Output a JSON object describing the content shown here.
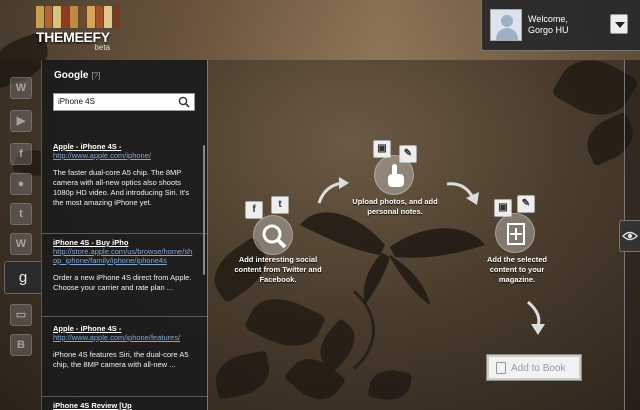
{
  "logo": {
    "title": "THEMEEFY",
    "badge": "beta"
  },
  "user": {
    "welcome": "Welcome,",
    "name": "Gorgo HU"
  },
  "panel": {
    "title": "Google",
    "count": "[?]",
    "search_value": "iPhone 4S",
    "results": [
      {
        "title": "Apple - iPhone 4S -",
        "url": "http://www.apple.com/iphone/",
        "desc": "The faster dual-core A5 chip. The 8MP camera with all-new optics also shoots 1080p HD video. And introducing Siri. It's the most amazing iPhone yet."
      },
      {
        "title": "iPhone 4S - Buy iPho",
        "url": "http://store.apple.com/us/browse/home/shop_iphone/family/iphone/iphone4s",
        "desc": "Order a new iPhone 4S direct from Apple. Choose your carrier and rate plan ..."
      },
      {
        "title": "Apple - iPhone 4S -",
        "url": "http://www.apple.com/iphone/features/",
        "desc": "iPhone 4S features Siri, the dual-core A5 chip, the 8MP camera with all-new ..."
      },
      {
        "title": "iPhone 4S Review [Up",
        "url": "",
        "desc": ""
      }
    ]
  },
  "rail": {
    "icons": [
      "wordpress-icon",
      "youtube-icon",
      "facebook-icon",
      "flickr-icon",
      "twitter-icon",
      "wikipedia-icon",
      "google-icon",
      "folder-icon",
      "blogger-icon"
    ],
    "active": "google-icon"
  },
  "workflow": {
    "step1": "Add interesting social content from Twitter and Facebook.",
    "step2": "Upload photos, and add personal notes.",
    "step3": "Add the selected content to your magazine."
  },
  "add_to_book": "Add to Book",
  "colors": {
    "link": "#7fa7d8",
    "panel_bg": "#1c1c1c"
  }
}
